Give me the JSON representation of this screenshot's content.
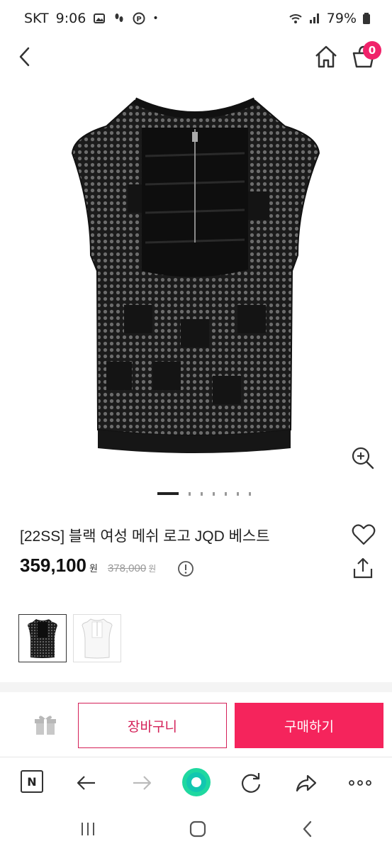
{
  "status_bar": {
    "carrier": "SKT",
    "time": "9:06",
    "battery": "79%"
  },
  "header": {
    "cart_count": "0"
  },
  "gallery": {
    "total_slides": 7,
    "active_slide": 1
  },
  "product": {
    "title": "[22SS] 블랙 여성 메쉬 로고 JQD 베스트",
    "price": "359,100",
    "price_unit": "원",
    "original_price": "378,000",
    "original_unit": "원"
  },
  "color_options": [
    {
      "name": "black",
      "selected": true
    },
    {
      "name": "white",
      "selected": false
    }
  ],
  "actions": {
    "add_to_cart": "장바구니",
    "buy_now": "구매하기"
  },
  "browser_toolbar": {
    "naver_label": "N"
  },
  "colors": {
    "accent": "#f5245c",
    "badge": "#f0226a",
    "outline": "#d42058"
  }
}
